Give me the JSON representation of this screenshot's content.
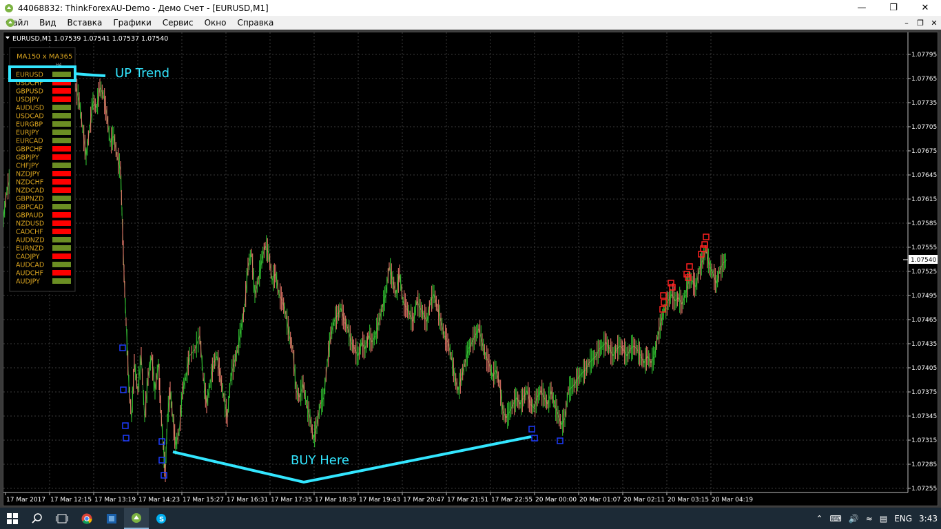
{
  "window": {
    "title": "44068832: ThinkForexAU-Demo - Демо Счет - [EURUSD,M1]"
  },
  "menu": {
    "items": [
      "Файл",
      "Вид",
      "Вставка",
      "Графики",
      "Сервис",
      "Окно",
      "Справка"
    ]
  },
  "chart": {
    "header": "EURUSD,M1  1.07539 1.07541 1.07537 1.07540",
    "current_price": "1.07540",
    "price_axis": [
      "1.07795",
      "1.07765",
      "1.07735",
      "1.07705",
      "1.07675",
      "1.07645",
      "1.07615",
      "1.07585",
      "1.07555",
      "1.07525",
      "1.07495",
      "1.07465",
      "1.07435",
      "1.07405",
      "1.07375",
      "1.07345",
      "1.07315",
      "1.07285",
      "1.07255"
    ],
    "time_axis": [
      "17 Mar 2017",
      "17 Mar 12:15",
      "17 Mar 13:19",
      "17 Mar 14:23",
      "17 Mar 15:27",
      "17 Mar 16:31",
      "17 Mar 17:35",
      "17 Mar 18:39",
      "17 Mar 19:43",
      "17 Mar 20:47",
      "17 Mar 21:51",
      "17 Mar 22:55",
      "20 Mar 00:00",
      "20 Mar 01:07",
      "20 Mar 02:11",
      "20 Mar 03:15",
      "20 Mar 04:19"
    ],
    "bull_color": "#32cd32",
    "bear_color": "#fa8072"
  },
  "indicator": {
    "title": "MA150  x  MA365",
    "subtitle": "H4",
    "up_color": "#6b8e23",
    "down_color": "#ff0000",
    "pairs": [
      {
        "name": "EURUSD",
        "trend": "up"
      },
      {
        "name": "USDCHF",
        "trend": "down"
      },
      {
        "name": "GBPUSD",
        "trend": "down"
      },
      {
        "name": "USDJPY",
        "trend": "down"
      },
      {
        "name": "AUDUSD",
        "trend": "up"
      },
      {
        "name": "USDCAD",
        "trend": "up"
      },
      {
        "name": "EURGBP",
        "trend": "up"
      },
      {
        "name": "EURJPY",
        "trend": "up"
      },
      {
        "name": "EURCAD",
        "trend": "up"
      },
      {
        "name": "GBPCHF",
        "trend": "down"
      },
      {
        "name": "GBPJPY",
        "trend": "down"
      },
      {
        "name": "CHFJPY",
        "trend": "up"
      },
      {
        "name": "NZDJPY",
        "trend": "down"
      },
      {
        "name": "NZDCHF",
        "trend": "down"
      },
      {
        "name": "NZDCAD",
        "trend": "down"
      },
      {
        "name": "GBPNZD",
        "trend": "up"
      },
      {
        "name": "GBPCAD",
        "trend": "up"
      },
      {
        "name": "GBPAUD",
        "trend": "down"
      },
      {
        "name": "NZDUSD",
        "trend": "down"
      },
      {
        "name": "CADCHF",
        "trend": "down"
      },
      {
        "name": "AUDNZD",
        "trend": "up"
      },
      {
        "name": "EURNZD",
        "trend": "up"
      },
      {
        "name": "CADJPY",
        "trend": "down"
      },
      {
        "name": "AUDCAD",
        "trend": "up"
      },
      {
        "name": "AUDCHF",
        "trend": "down"
      },
      {
        "name": "AUDJPY",
        "trend": "up"
      }
    ]
  },
  "annotations": {
    "up_trend": "UP Trend",
    "buy_here": "BUY Here",
    "color": "#33e6ff"
  },
  "taskbar": {
    "lang": "ENG",
    "clock": "3:43"
  }
}
